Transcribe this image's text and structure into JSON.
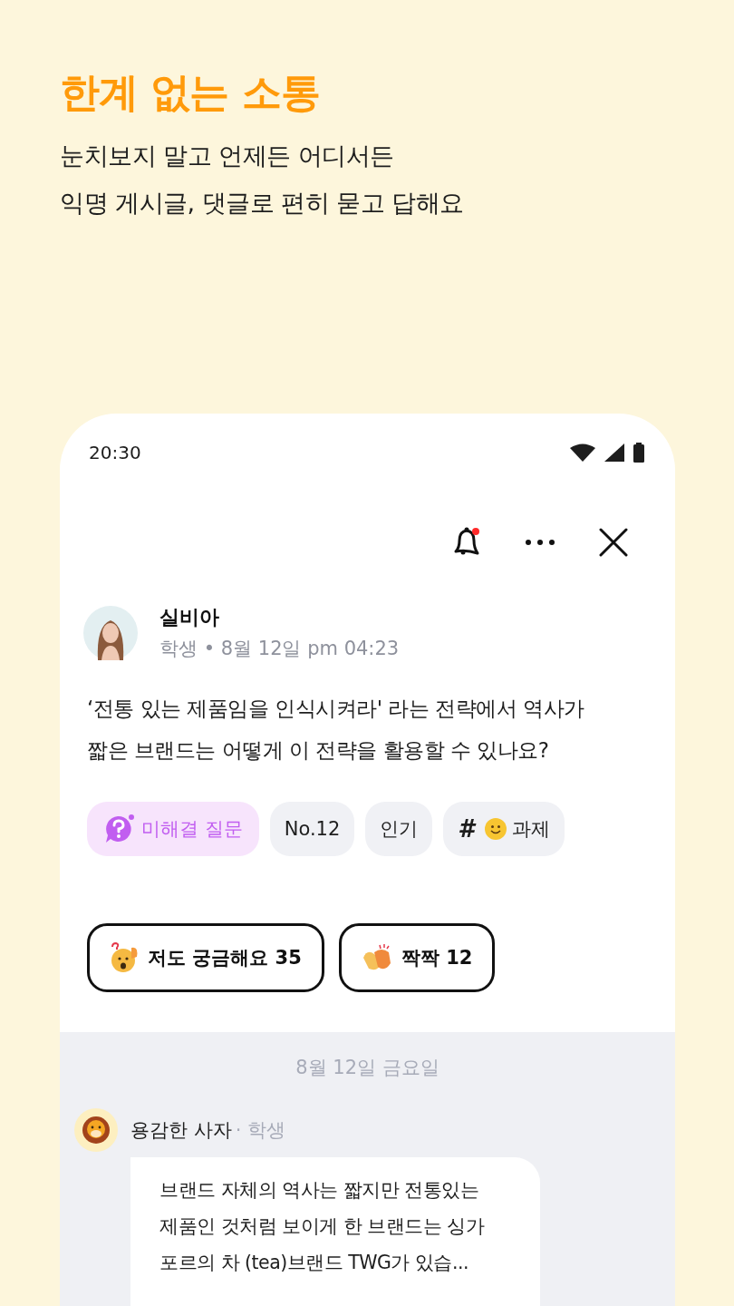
{
  "headline": {
    "title": "한계 없는 소통",
    "subtitle_lines": [
      "눈치보지 말고 언제든 어디서든",
      "익명 게시글,  댓글로 편히 묻고 답해요"
    ]
  },
  "status_bar": {
    "time": "20:30"
  },
  "toolbar": {
    "notification_badge": true
  },
  "post": {
    "author": "실비아",
    "meta": "학생 • 8월 12일 pm 04:23",
    "text_lines": [
      "‘전통 있는 제품임을 인식시켜라' 라는 전략에서 역사가",
      "짧은 브랜드는 어떻게 이 전략을 활용할 수 있나요?"
    ],
    "tags": [
      {
        "kind": "status",
        "label": "미해결 질문"
      },
      {
        "kind": "plain",
        "label": "No.12"
      },
      {
        "kind": "plain",
        "label": "인기"
      },
      {
        "kind": "topic",
        "prefix": "#",
        "label": "과제"
      }
    ],
    "reactions": [
      {
        "kind": "curious",
        "label": "저도 궁금해요 35"
      },
      {
        "kind": "clap",
        "label": "짝짝 12"
      }
    ]
  },
  "comments": {
    "date": "8월 12일 금요일",
    "items": [
      {
        "author": "용감한 사자",
        "role": "· 학생",
        "text_lines": [
          "브랜드 자체의 역사는 짧지만 전통있는",
          "제품인 것처럼 보이게 한 브랜드는 싱가",
          "포르의 차 (tea)브랜드 TWG가 있습..."
        ]
      }
    ]
  }
}
